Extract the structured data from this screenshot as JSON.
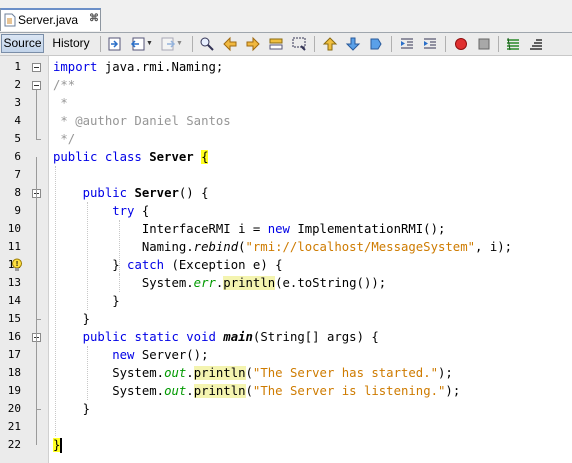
{
  "tab": {
    "file_name": "Server.java",
    "close_glyph": "⌘"
  },
  "toolbar": {
    "source_label": "Source",
    "history_label": "History",
    "icons": [
      "last-edit-icon",
      "back-icon",
      "forward-icon",
      "find-icon",
      "find-previous-icon",
      "find-next-icon",
      "toggle-highlight-icon",
      "find-selection-icon",
      "previous-bookmark-icon",
      "next-bookmark-icon",
      "toggle-bookmark-icon",
      "shift-left-icon",
      "shift-right-icon",
      "start-macro-icon",
      "stop-macro-icon",
      "comment-icon",
      "uncomment-icon"
    ]
  },
  "colors": {
    "keyword": "#0000e6",
    "comment": "#969696",
    "string": "#ce7b00",
    "field": "#009900",
    "highlight": "#f4f4b0",
    "brace_match": "#ffff22"
  },
  "editor": {
    "line_numbers": [
      "1",
      "2",
      "3",
      "4",
      "5",
      "6",
      "7",
      "8",
      "9",
      "10",
      "11",
      "12",
      "13",
      "14",
      "15",
      "16",
      "17",
      "18",
      "19",
      "20",
      "21",
      "22"
    ],
    "lines": [
      [
        {
          "t": "import",
          "c": "kw"
        },
        {
          "t": " java.rmi.Naming;"
        }
      ],
      [
        {
          "t": "/**",
          "c": "cm"
        }
      ],
      [
        {
          "t": " *",
          "c": "cm"
        }
      ],
      [
        {
          "t": " * @author Daniel Santos",
          "c": "cm"
        }
      ],
      [
        {
          "t": " */",
          "c": "cm"
        }
      ],
      [
        {
          "t": "public class ",
          "c": "kw"
        },
        {
          "t": "Server",
          "c": "b"
        },
        {
          "t": " "
        },
        {
          "t": "{",
          "c": "brace"
        }
      ],
      [],
      [
        {
          "t": "    "
        },
        {
          "t": "public ",
          "c": "kw"
        },
        {
          "t": "Server",
          "c": "b"
        },
        {
          "t": "() {"
        }
      ],
      [
        {
          "t": "        "
        },
        {
          "t": "try",
          "c": "kw"
        },
        {
          "t": " {"
        }
      ],
      [
        {
          "t": "            InterfaceRMI i = "
        },
        {
          "t": "new",
          "c": "kw"
        },
        {
          "t": " ImplementationRMI();"
        }
      ],
      [
        {
          "t": "            Naming."
        },
        {
          "t": "rebind",
          "c": "it"
        },
        {
          "t": "("
        },
        {
          "t": "\"rmi://localhost/MessageSystem\"",
          "c": "st"
        },
        {
          "t": ", i);"
        }
      ],
      [
        {
          "t": "        } "
        },
        {
          "t": "catch",
          "c": "kw"
        },
        {
          "t": " (Exception e) {"
        }
      ],
      [
        {
          "t": "            System."
        },
        {
          "t": "err",
          "c": "fld"
        },
        {
          "t": "."
        },
        {
          "t": "println",
          "c": "hl"
        },
        {
          "t": "(e.toString());"
        }
      ],
      [
        {
          "t": "        }"
        }
      ],
      [
        {
          "t": "    }"
        }
      ],
      [
        {
          "t": "    "
        },
        {
          "t": "public static void ",
          "c": "kw"
        },
        {
          "t": "main",
          "c": "b it"
        },
        {
          "t": "(String[] args) {"
        }
      ],
      [
        {
          "t": "        "
        },
        {
          "t": "new",
          "c": "kw"
        },
        {
          "t": " Server();"
        }
      ],
      [
        {
          "t": "        System."
        },
        {
          "t": "out",
          "c": "fld"
        },
        {
          "t": "."
        },
        {
          "t": "println",
          "c": "hl"
        },
        {
          "t": "("
        },
        {
          "t": "\"The Server has started.\"",
          "c": "st"
        },
        {
          "t": ");"
        }
      ],
      [
        {
          "t": "        System."
        },
        {
          "t": "out",
          "c": "fld"
        },
        {
          "t": "."
        },
        {
          "t": "println",
          "c": "hl"
        },
        {
          "t": "("
        },
        {
          "t": "\"The Server is listening.\"",
          "c": "st"
        },
        {
          "t": ");"
        }
      ],
      [
        {
          "t": "    }"
        }
      ],
      [],
      [
        {
          "t": "}",
          "c": "brace"
        },
        {
          "caret": true
        }
      ]
    ],
    "warning_lines": [
      12
    ]
  }
}
